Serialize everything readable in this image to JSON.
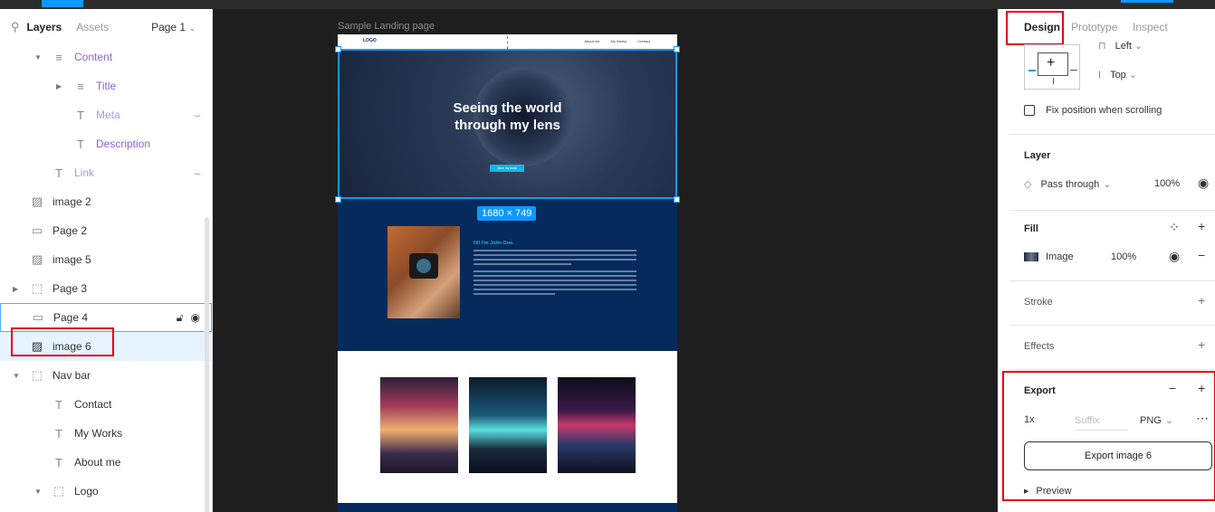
{
  "left_panel": {
    "tabs": {
      "layers": "Layers",
      "assets": "Assets"
    },
    "page_selector": "Page 1",
    "layers": [
      {
        "name": "Content",
        "icon": "auto-layout-icon"
      },
      {
        "name": "Title",
        "icon": "auto-layout-icon"
      },
      {
        "name": "Meta",
        "icon": "text-icon"
      },
      {
        "name": "Description",
        "icon": "text-icon"
      },
      {
        "name": "Link",
        "icon": "text-icon"
      },
      {
        "name": "image 2",
        "icon": "image-icon"
      },
      {
        "name": "Page 2",
        "icon": "rectangle-icon"
      },
      {
        "name": "image 5",
        "icon": "image-icon"
      },
      {
        "name": "Page 3",
        "icon": "frame-icon"
      },
      {
        "name": "Page 4",
        "icon": "rectangle-icon"
      },
      {
        "name": "image 6",
        "icon": "image-icon"
      },
      {
        "name": "Nav bar",
        "icon": "frame-icon"
      },
      {
        "name": "Contact",
        "icon": "text-icon"
      },
      {
        "name": "My Works",
        "icon": "text-icon"
      },
      {
        "name": "About me",
        "icon": "text-icon"
      },
      {
        "name": "Logo",
        "icon": "frame-icon"
      }
    ]
  },
  "canvas": {
    "frame_label": "Sample Landing page",
    "nav": {
      "logo": "LOGO",
      "links": [
        "About me",
        "My Works",
        "Contact"
      ]
    },
    "hero": {
      "title": "Seeing the world through my lens",
      "button": "View my work"
    },
    "about": {
      "greeting": "Hi! I'm John Doe."
    },
    "selection_size": "1680 × 749"
  },
  "right_panel": {
    "tabs": {
      "design": "Design",
      "prototype": "Prototype",
      "inspect": "Inspect"
    },
    "constraints": {
      "horizontal": "Left",
      "vertical": "Top"
    },
    "fix_position": "Fix position when scrolling",
    "layer": {
      "title": "Layer",
      "blend": "Pass through",
      "opacity": "100%"
    },
    "fill": {
      "title": "Fill",
      "type": "Image",
      "opacity": "100%"
    },
    "stroke": {
      "title": "Stroke"
    },
    "effects": {
      "title": "Effects"
    },
    "export": {
      "title": "Export",
      "scale": "1x",
      "suffix_placeholder": "Suffix",
      "format": "PNG",
      "button": "Export image 6",
      "preview": "Preview"
    }
  },
  "colors": {
    "accent": "#0d99ff",
    "highlight_red": "#e0000b",
    "layer_purple": "#8a63d2"
  }
}
